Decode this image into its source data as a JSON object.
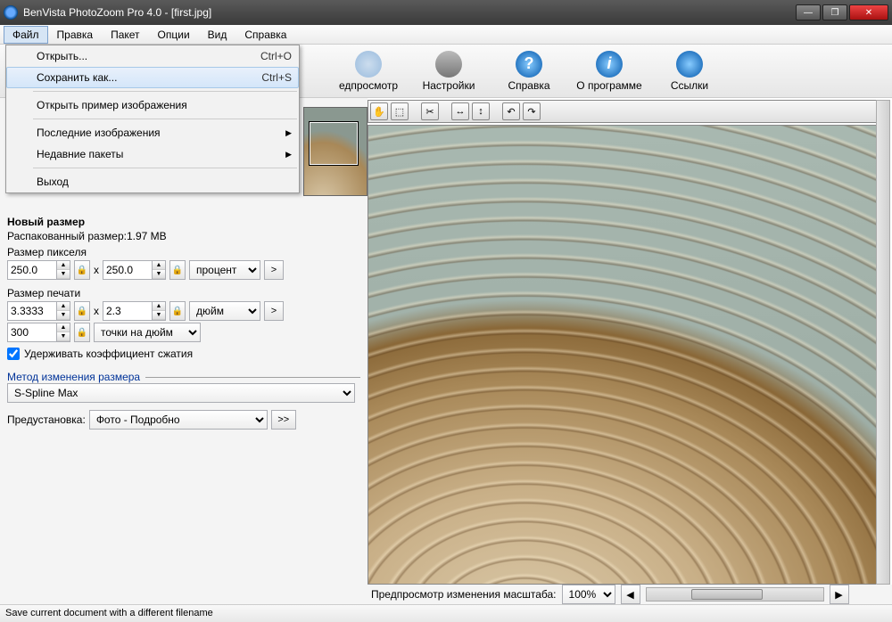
{
  "window": {
    "title": "BenVista PhotoZoom Pro 4.0 - [first.jpg]"
  },
  "menubar": [
    "Файл",
    "Правка",
    "Пакет",
    "Опции",
    "Вид",
    "Справка"
  ],
  "file_menu": {
    "open": {
      "label": "Открыть...",
      "shortcut": "Ctrl+O"
    },
    "save_as": {
      "label": "Сохранить как...",
      "shortcut": "Ctrl+S"
    },
    "open_sample": {
      "label": "Открыть пример изображения"
    },
    "recent_images": {
      "label": "Последние изображения"
    },
    "recent_batches": {
      "label": "Недавние пакеты"
    },
    "exit": {
      "label": "Выход"
    }
  },
  "toolbar": {
    "preview": "едпросмотр",
    "settings": "Настройки",
    "help": "Справка",
    "about": "О программе",
    "links": "Ссылки"
  },
  "left": {
    "new_size_title": "Новый размер",
    "unpacked_label": "Распакованный размер:1.97 MB",
    "pixel_size_label": "Размер пикселя",
    "pixel_w": "250.0",
    "pixel_h": "250.0",
    "pixel_unit": "процент",
    "x": "x",
    "print_size_label": "Размер печати",
    "print_w": "3.3333",
    "print_h": "2.3",
    "print_unit": "дюйм",
    "dpi": "300",
    "dpi_unit": "точки на дюйм",
    "keep_ratio": "Удерживать коэффициент сжатия",
    "method_group": "Метод изменения размера",
    "method": "S-Spline Max",
    "preset_label": "Предустановка:",
    "preset": "Фото - Подробно",
    "more": ">>"
  },
  "right": {
    "preview_scale_label": "Предпросмотр изменения масштаба:",
    "zoom": "100%"
  },
  "status": "Save current document with a different filename"
}
